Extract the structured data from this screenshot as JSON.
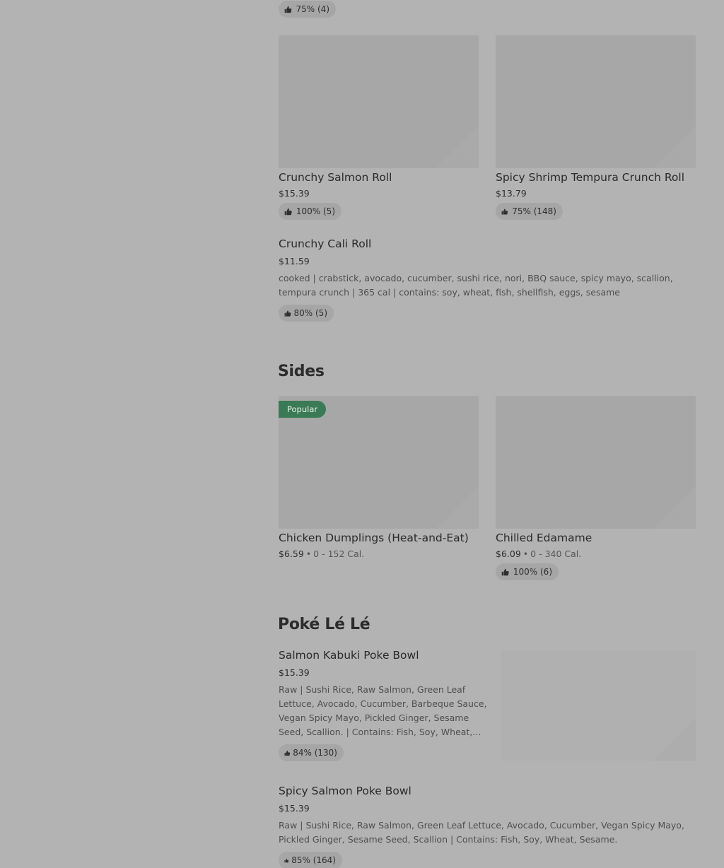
{
  "top_item": {
    "rating": "75% (4)"
  },
  "rolls": [
    {
      "name": "Crunchy Salmon Roll",
      "price": "$15.39",
      "rating": "100% (5)"
    },
    {
      "name": "Spicy Shrimp Tempura Crunch Roll",
      "price": "$13.79",
      "rating": "75% (148)"
    }
  ],
  "cali_roll": {
    "name": "Crunchy Cali Roll",
    "price": "$11.59",
    "description": "cooked | crabstick, avocado, cucumber, sushi rice, nori, BBQ sauce, spicy mayo, scallion, tempura crunch | 365 cal | contains: soy, wheat, fish, shellfish, eggs, sesame",
    "rating": "80% (5)"
  },
  "sides": {
    "heading": "Sides",
    "badge": "Popular",
    "items": [
      {
        "name": "Chicken Dumplings (Heat-and-Eat)",
        "price": "$6.59",
        "calories": "0 - 152 Cal."
      },
      {
        "name": "Chilled Edamame",
        "price": "$6.09",
        "calories": "0 - 340 Cal.",
        "rating": "100% (6)"
      }
    ]
  },
  "poke": {
    "heading": "Poké Lé Lé",
    "items": [
      {
        "name": "Salmon Kabuki Poke Bowl",
        "price": "$15.39",
        "description": "Raw | Sushi Rice, Raw Salmon, Green Leaf Lettuce, Avocado, Cucumber, Barbeque Sauce, Vegan Spicy Mayo, Pickled Ginger, Sesame Seed, Scallion. | Contains: Fish, Soy, Wheat,...",
        "rating": "84% (130)"
      },
      {
        "name": "Spicy Salmon Poke Bowl",
        "price": "$15.39",
        "description": "Raw | Sushi Rice, Raw Salmon, Green Leaf Lettuce, Avocado, Cucumber, Vegan Spicy Mayo, Pickled Ginger, Sesame Seed, Scallion | Contains: Fish, Soy, Wheat, Sesame.",
        "rating": "85% (164)"
      }
    ]
  },
  "icons": {
    "rating": "thumbs-up-icon"
  }
}
